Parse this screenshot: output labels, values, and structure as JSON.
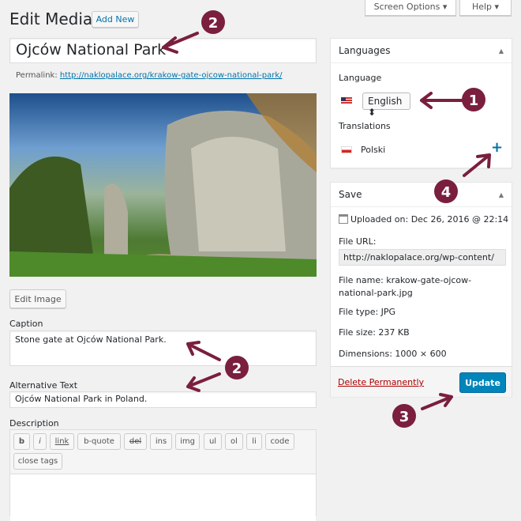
{
  "header": {
    "title": "Edit Media",
    "add_new": "Add New",
    "screen_options": "Screen Options ▾",
    "help": "Help ▾"
  },
  "post": {
    "title": "Ojców National Park",
    "permalink_label": "Permalink:",
    "permalink_url": "http://naklopalace.org/krakow-gate-ojcow-national-park/"
  },
  "media": {
    "edit_image": "Edit Image",
    "caption_label": "Caption",
    "caption": "Stone gate at Ojców National Park.",
    "alt_label": "Alternative Text",
    "alt": "Ojców National Park in Poland.",
    "description_label": "Description",
    "toolbar": [
      "b",
      "i",
      "link",
      "b-quote",
      "del",
      "ins",
      "img",
      "ul",
      "ol",
      "li",
      "code"
    ],
    "close_tags": "close tags"
  },
  "languages": {
    "title": "Languages",
    "language_label": "Language",
    "selected": "English",
    "translations_label": "Translations",
    "translation": "Polski"
  },
  "save": {
    "title": "Save",
    "uploaded": "Uploaded on: Dec 26, 2016 @ 22:14",
    "file_url_label": "File URL:",
    "file_url": "http://naklopalace.org/wp-content/",
    "file_name_1": "File name: krakow-gate-ojcow-",
    "file_name_2": "national-park.jpg",
    "file_type": "File type: JPG",
    "file_size": "File size: 237 KB",
    "dimensions": "Dimensions: 1000 × 600",
    "delete": "Delete Permanently",
    "update": "Update"
  },
  "annotations": [
    "2",
    "1",
    "4",
    "2",
    "3"
  ],
  "colors": {
    "accent": "#0085ba",
    "annotation": "#7a1f3d",
    "delete": "#a00",
    "link": "#0073aa"
  }
}
